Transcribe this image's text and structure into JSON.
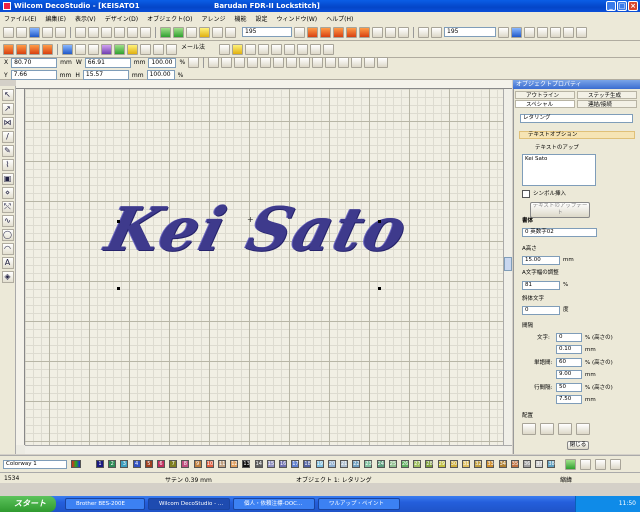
{
  "window": {
    "app_title": "Wilcom DecoStudio - [KEISATO1",
    "machine": "Barudan FDR-II Lockstitch]"
  },
  "menu": [
    "ファイル(E)",
    "編集(E)",
    "表示(V)",
    "デザイン(D)",
    "オブジェクト(O)",
    "アレンジ",
    "機能",
    "設定",
    "ウィンドウ(W)",
    "ヘルプ(H)"
  ],
  "toolbar": {
    "font_mode": "メール法",
    "value1": "195",
    "value2": "195"
  },
  "coords": {
    "x_label": "X",
    "x_value": "80.70",
    "y_label": "Y",
    "y_value": "7.66",
    "unit": "mm",
    "w_label": "W",
    "w_value": "66.91",
    "h_label": "H",
    "h_value": "15.57",
    "w_pct": "100.00",
    "h_pct": "100.00",
    "pct": "%"
  },
  "design": {
    "text": "Kei Sato",
    "thread_color": "#3e3a8c"
  },
  "panel": {
    "title": "オブジェクトプロパティ",
    "tab_outline": "アウトライン",
    "tab_stitch": "ステッチ生成",
    "tab_special": "スペシャル",
    "tab_connect": "連結/接続",
    "type_select": "レタリング",
    "section": "テキストオプション",
    "text_up_label": "テキストのアップ",
    "text_value": "Kei Sato",
    "symbol_label": "シンボル挿入",
    "update_btn": "テキストのアップデート",
    "font_label": "書体",
    "font_value": "0 英数字02",
    "height_label": "A高さ",
    "height_value": "15.00",
    "unit_mm": "mm",
    "width_label": "A文字幅の調整",
    "width_value": "81",
    "unit_pct": "%",
    "italic_label": "斜体文字",
    "italic_value": "0",
    "unit_deg": "度",
    "spacing_label": "間隔",
    "char_label": "文字:",
    "char_pct": "0",
    "char_pct_unit": "% (高さの)",
    "char_mm": "0.10",
    "word_label": "単語間:",
    "word_pct": "60",
    "word_mm": "9.00",
    "line_label": "行間隔:",
    "line_pct": "50",
    "line_mm": "7.50",
    "align_label": "配置",
    "close_btn": "閉じる"
  },
  "colorbar": {
    "colorway": "Colorway 1",
    "swatches": [
      {
        "n": "1",
        "c": "#1a1a80"
      },
      {
        "n": "2",
        "c": "#2e8b57"
      },
      {
        "n": "3",
        "c": "#40a0c0"
      },
      {
        "n": "4",
        "c": "#3050c0"
      },
      {
        "n": "5",
        "c": "#a04020"
      },
      {
        "n": "6",
        "c": "#c03060"
      },
      {
        "n": "7",
        "c": "#808020"
      },
      {
        "n": "8",
        "c": "#c05080"
      },
      {
        "n": "9",
        "c": "#c08040"
      },
      {
        "n": "10",
        "c": "#e06040"
      },
      {
        "n": "11",
        "c": "#c0a080"
      },
      {
        "n": "12",
        "c": "#e0a060"
      },
      {
        "n": "13",
        "c": "#101010"
      },
      {
        "n": "14",
        "c": "#606060"
      },
      {
        "n": "15",
        "c": "#9090c0"
      },
      {
        "n": "16",
        "c": "#7070b0"
      },
      {
        "n": "17",
        "c": "#6080d0"
      },
      {
        "n": "18",
        "c": "#5060a0"
      },
      {
        "n": "19",
        "c": "#80c0e0"
      },
      {
        "n": "20",
        "c": "#90b0d0"
      },
      {
        "n": "21",
        "c": "#b0c0d0"
      },
      {
        "n": "22",
        "c": "#70a0c0"
      },
      {
        "n": "23",
        "c": "#80c0a0"
      },
      {
        "n": "24",
        "c": "#60a080"
      },
      {
        "n": "25",
        "c": "#90c090"
      },
      {
        "n": "26",
        "c": "#60b060"
      },
      {
        "n": "27",
        "c": "#a0c060"
      },
      {
        "n": "28",
        "c": "#80a040"
      },
      {
        "n": "29",
        "c": "#c0c040"
      },
      {
        "n": "30",
        "c": "#d0b040"
      },
      {
        "n": "31",
        "c": "#e0c060"
      },
      {
        "n": "32",
        "c": "#c0a040"
      },
      {
        "n": "33",
        "c": "#d09030"
      },
      {
        "n": "34",
        "c": "#b08030"
      },
      {
        "n": "35",
        "c": "#c07040"
      },
      {
        "n": "36",
        "c": "#a0a0a0"
      },
      {
        "n": "37",
        "c": "#d0d0d0"
      },
      {
        "n": "38",
        "c": "#60a0c0"
      }
    ]
  },
  "status": {
    "stitches": "1534",
    "size": "サテン 0.39 mm",
    "object": "オブジェクト 1: レタリング",
    "mode": "縮緯"
  },
  "taskbar": {
    "start": "スタート",
    "tasks": [
      "Brother BES-200E",
      "Wilcom DecoStudio - ...",
      "個人・依頼注標-OOC...",
      "ワルアップ・ペイント"
    ],
    "time": "11:50"
  }
}
